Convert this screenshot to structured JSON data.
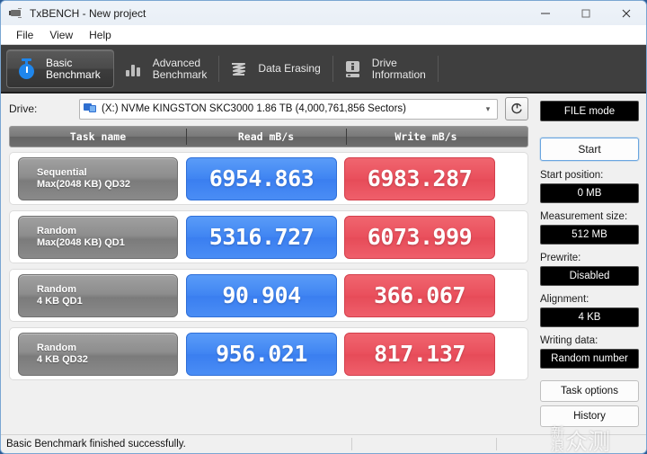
{
  "window": {
    "title": "TxBENCH - New project",
    "icon": "plug-icon",
    "minimize": "minimize-icon",
    "maximize": "maximize-icon",
    "close": "close-icon"
  },
  "menu": {
    "items": [
      {
        "label": "File"
      },
      {
        "label": "View"
      },
      {
        "label": "Help"
      }
    ]
  },
  "tabs": [
    {
      "label": "Basic\nBenchmark",
      "icon": "stopwatch-icon",
      "active": true
    },
    {
      "label": "Advanced\nBenchmark",
      "icon": "bar-chart-icon",
      "active": false
    },
    {
      "label": "Data Erasing",
      "icon": "shred-icon",
      "active": false
    },
    {
      "label": "Drive\nInformation",
      "icon": "drive-info-icon",
      "active": false
    }
  ],
  "drive": {
    "label": "Drive:",
    "icon": "drive-icon",
    "value": "(X:) NVMe KINGSTON SKC3000  1.86 TB (4,000,761,856 Sectors)",
    "caret": "chevron-down-icon",
    "refresh": "refresh-icon"
  },
  "table": {
    "headers": [
      "Task name",
      "Read mB/s",
      "Write mB/s"
    ],
    "rows": [
      {
        "task_line1": "Sequential",
        "task_line2": "Max(2048 KB) QD32",
        "read": "6954.863",
        "write": "6983.287"
      },
      {
        "task_line1": "Random",
        "task_line2": "Max(2048 KB) QD1",
        "read": "5316.727",
        "write": "6073.999"
      },
      {
        "task_line1": "Random",
        "task_line2": "4 KB QD1",
        "read": "90.904",
        "write": "366.067"
      },
      {
        "task_line1": "Random",
        "task_line2": "4 KB QD32",
        "read": "956.021",
        "write": "817.137"
      }
    ]
  },
  "sidebar": {
    "mode_button": "FILE mode",
    "start_button": "Start",
    "fields": [
      {
        "label": "Start position:",
        "value": "0 MB"
      },
      {
        "label": "Measurement size:",
        "value": "512 MB"
      },
      {
        "label": "Prewrite:",
        "value": "Disabled"
      },
      {
        "label": "Alignment:",
        "value": "4 KB"
      },
      {
        "label": "Writing data:",
        "value": "Random number"
      }
    ],
    "task_options_button": "Task options",
    "history_button": "History"
  },
  "statusbar": {
    "message": "Basic Benchmark finished successfully."
  },
  "watermark": {
    "small_top": "新",
    "small_bottom": "浪",
    "big": "众测"
  },
  "colors": {
    "read_accent": "#4086F4",
    "write_accent": "#EB5360",
    "tabstrip_bg": "#3F3F3F",
    "window_bg": "#F0F0F0",
    "field_bg": "#000000"
  }
}
